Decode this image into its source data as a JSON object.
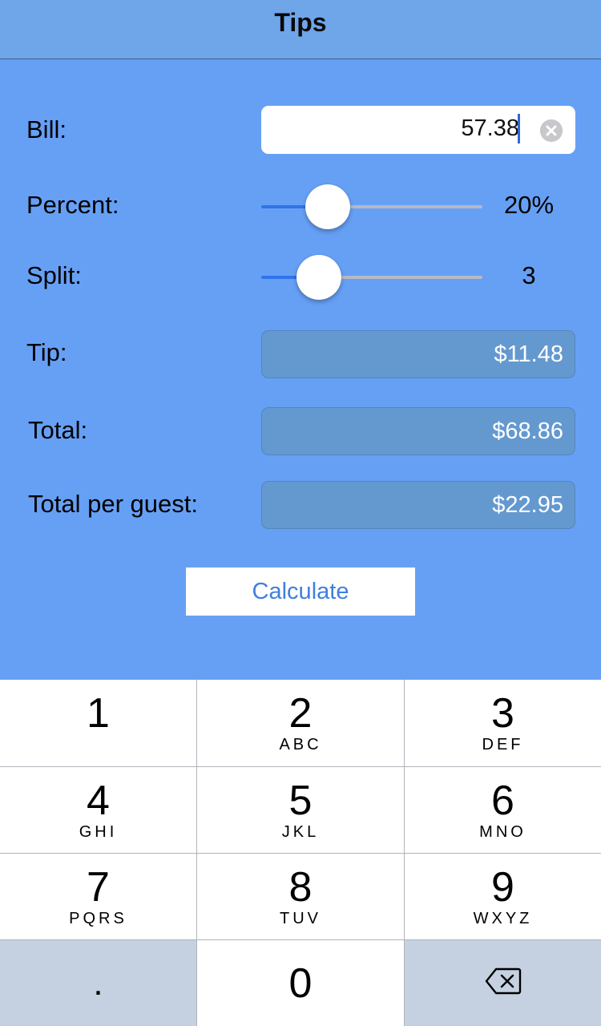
{
  "navbar": {
    "title": "Tips"
  },
  "form": {
    "bill_label": "Bill:",
    "bill_value": "57.38",
    "percent_label": "Percent:",
    "percent_value": "20%",
    "percent_level": 0.25,
    "split_label": "Split:",
    "split_value": "3",
    "split_level": 0.2,
    "tip_label": "Tip:",
    "tip_value": "$11.48",
    "total_label": "Total:",
    "total_value": "$68.86",
    "per_guest_label": "Total per guest:",
    "per_guest_value": "$22.95"
  },
  "calculate_button": {
    "label": "Calculate"
  },
  "keypad": {
    "keys": [
      {
        "num": "1",
        "letters": ""
      },
      {
        "num": "2",
        "letters": "ABC"
      },
      {
        "num": "3",
        "letters": "DEF"
      },
      {
        "num": "4",
        "letters": "GHI"
      },
      {
        "num": "5",
        "letters": "JKL"
      },
      {
        "num": "6",
        "letters": "MNO"
      },
      {
        "num": "7",
        "letters": "PQRS"
      },
      {
        "num": "8",
        "letters": "TUV"
      },
      {
        "num": "9",
        "letters": "WXYZ"
      },
      {
        "num": ".",
        "letters": ""
      },
      {
        "num": "0",
        "letters": ""
      }
    ],
    "delete_icon": "backspace-icon"
  },
  "colors": {
    "background": "#66a0f5",
    "navbar": "#6fa6ea",
    "output_field": "#6499d0",
    "accent": "#2f74ea",
    "button_text": "#3f7fe0",
    "keypad_dark": "#c5d1e1"
  }
}
